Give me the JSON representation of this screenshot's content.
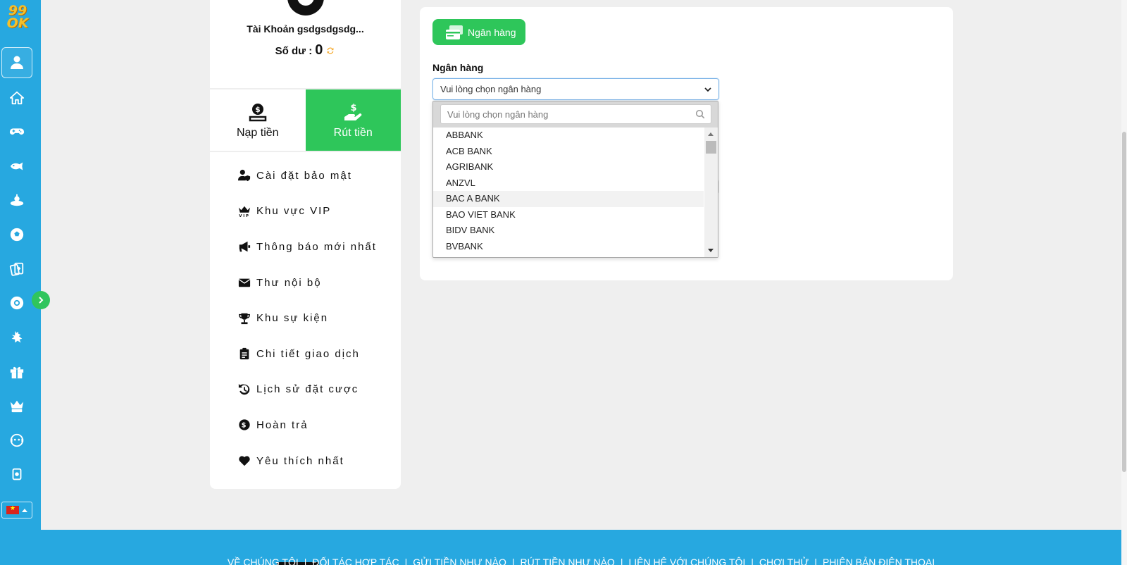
{
  "sidebar": {
    "logo_line1": "99",
    "logo_line2": "OK",
    "items": [
      {
        "name": "account",
        "icon": "user-icon"
      },
      {
        "name": "home",
        "icon": "home-icon"
      },
      {
        "name": "games",
        "icon": "gamepad-icon"
      },
      {
        "name": "fishing",
        "icon": "fish-icon"
      },
      {
        "name": "lottery",
        "icon": "lottery-icon"
      },
      {
        "name": "sports",
        "icon": "soccer-ball-icon"
      },
      {
        "name": "cards",
        "icon": "playing-cards-icon"
      },
      {
        "name": "billiards",
        "icon": "billiard-ball-icon"
      },
      {
        "name": "cockfight",
        "icon": "rooster-icon"
      },
      {
        "name": "promotions",
        "icon": "gift-icon"
      },
      {
        "name": "vip",
        "icon": "vip-crown-icon"
      },
      {
        "name": "support",
        "icon": "support-agent-icon"
      },
      {
        "name": "responsible",
        "icon": "hand-card-icon"
      }
    ],
    "language": "vi"
  },
  "account": {
    "name": "Tài Khoản gsdgsdgsdg...",
    "balance_label": "Số dư :",
    "balance_value": "0",
    "tabs": [
      {
        "label": "Nạp tiền",
        "icon": "deposit-icon",
        "active": false
      },
      {
        "label": "Rút tiền",
        "icon": "withdraw-icon",
        "active": true
      }
    ],
    "menu": [
      {
        "label": "Cài đặt bảo mật",
        "icon": "user-shield-icon"
      },
      {
        "label": "Khu vực VIP",
        "icon": "vip-crown-icon"
      },
      {
        "label": "Thông báo mới nhất",
        "icon": "megaphone-icon"
      },
      {
        "label": "Thư nội bộ",
        "icon": "envelope-icon"
      },
      {
        "label": "Khu sự kiện",
        "icon": "trophy-icon"
      },
      {
        "label": "Chi tiết giao dịch",
        "icon": "clipboard-icon"
      },
      {
        "label": "Lịch sử đặt cược",
        "icon": "history-icon"
      },
      {
        "label": "Hoàn trả",
        "icon": "dollar-coin-icon"
      },
      {
        "label": "Yêu thích nhất",
        "icon": "heart-icon"
      }
    ]
  },
  "withdraw": {
    "method_button": "Ngân hàng",
    "bank_label": "Ngân hàng",
    "select_placeholder": "Vui lòng chọn ngân hàng",
    "search_placeholder": "Vui lòng chọn ngân hàng",
    "banks": [
      "ABBANK",
      "ACB BANK",
      "AGRIBANK",
      "ANZVL",
      "BAC A BANK",
      "BAO VIET BANK",
      "BIDV BANK",
      "BVBANK"
    ],
    "hovered_bank": "BAC A BANK"
  },
  "footer": {
    "links": [
      "VỀ CHÚNG TÔI",
      "ĐỐI TÁC HỢP TÁC",
      "GỬI TIỀN NHƯ NÀO",
      "RÚT TIỀN NHƯ NÀO",
      "LIÊN HỆ VỚI CHÚNG TÔI",
      "CHƠI THỬ",
      "PHIÊN BẢN ĐIỆN THOẠI"
    ]
  },
  "colors": {
    "sidebar_blue": "#27a8e0",
    "accent_green": "#2ec65a",
    "refresh_orange": "#f5a623"
  }
}
